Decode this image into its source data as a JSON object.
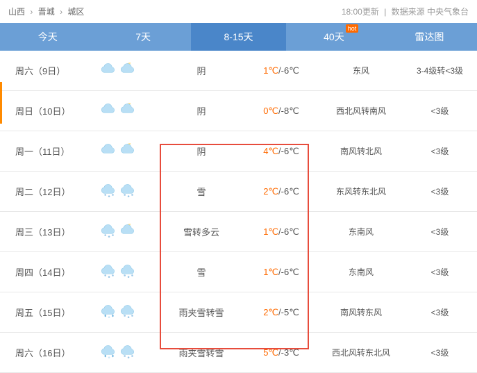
{
  "breadcrumb": {
    "l1": "山西",
    "l2": "晋城",
    "l3": "城区",
    "update": "18:00更新",
    "source": "数据来源 中央气象台"
  },
  "tabs": [
    {
      "label": "今天"
    },
    {
      "label": "7天"
    },
    {
      "label": "8-15天"
    },
    {
      "label": "40天",
      "hot": "hot"
    },
    {
      "label": "雷达图"
    }
  ],
  "days": [
    {
      "date": "周六（9日）",
      "icon1": "cloudy",
      "icon2": "cloudy-night",
      "weather": "阴",
      "hi": "1℃",
      "lo": "/-6℃",
      "wind": "东风",
      "level": "3-4级转<3级"
    },
    {
      "date": "周日（10日）",
      "icon1": "cloudy",
      "icon2": "cloudy-night",
      "weather": "阴",
      "hi": "0℃",
      "lo": "/-8℃",
      "wind": "西北风转南风",
      "level": "<3级"
    },
    {
      "date": "周一（11日）",
      "icon1": "cloudy",
      "icon2": "cloudy-night",
      "weather": "阴",
      "hi": "4℃",
      "lo": "/-6℃",
      "wind": "南风转北风",
      "level": "<3级"
    },
    {
      "date": "周二（12日）",
      "icon1": "snow",
      "icon2": "snow",
      "weather": "雪",
      "hi": "2℃",
      "lo": "/-6℃",
      "wind": "东风转东北风",
      "level": "<3级"
    },
    {
      "date": "周三（13日）",
      "icon1": "snow",
      "icon2": "cloudy-night",
      "weather": "雪转多云",
      "hi": "1℃",
      "lo": "/-6℃",
      "wind": "东南风",
      "level": "<3级"
    },
    {
      "date": "周四（14日）",
      "icon1": "snow",
      "icon2": "snow",
      "weather": "雪",
      "hi": "1℃",
      "lo": "/-6℃",
      "wind": "东南风",
      "level": "<3级"
    },
    {
      "date": "周五（15日）",
      "icon1": "sleet",
      "icon2": "snow",
      "weather": "雨夹雪转雪",
      "hi": "2℃",
      "lo": "/-5℃",
      "wind": "南风转东风",
      "level": "<3级"
    },
    {
      "date": "周六（16日）",
      "icon1": "sleet",
      "icon2": "snow",
      "weather": "雨夹雪转雪",
      "hi": "5℃",
      "lo": "/-3℃",
      "wind": "西北风转东北风",
      "level": "<3级"
    }
  ]
}
